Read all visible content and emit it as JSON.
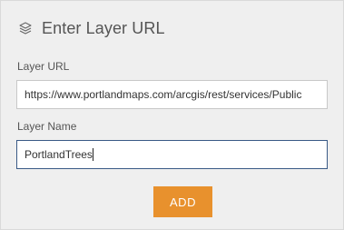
{
  "header": {
    "icon": "layers-icon",
    "title": "Enter Layer URL"
  },
  "layer_url": {
    "label": "Layer URL",
    "value": "https://www.portlandmaps.com/arcgis/rest/services/Public"
  },
  "layer_name": {
    "label": "Layer Name",
    "value": "PortlandTrees"
  },
  "actions": {
    "add_label": "ADD"
  },
  "colors": {
    "panel_bg": "#efefef",
    "accent": "#e8912d",
    "focus_border": "#3a5a86",
    "text": "#555555"
  }
}
